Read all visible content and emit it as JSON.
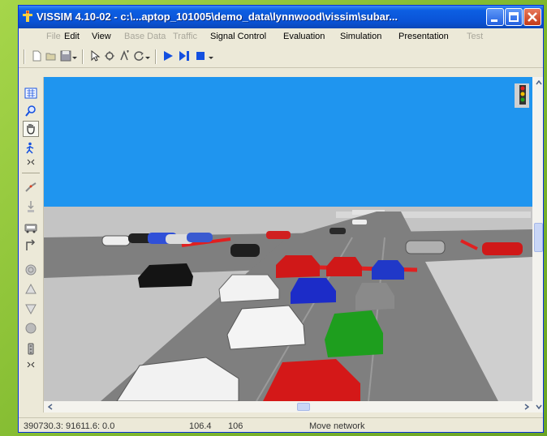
{
  "window": {
    "title": "VISSIM 4.10-02 - c:\\...aptop_101005\\demo_data\\lynnwood\\vissim\\subar...",
    "minimize_label": "minimize",
    "maximize_label": "maximize",
    "close_label": "close"
  },
  "menu": {
    "items": [
      {
        "label": "File",
        "enabled": false
      },
      {
        "label": "Edit",
        "enabled": true
      },
      {
        "label": "View",
        "enabled": true
      },
      {
        "label": "Base Data",
        "enabled": false
      },
      {
        "label": "Traffic",
        "enabled": false
      },
      {
        "label": "Signal Control",
        "enabled": true
      },
      {
        "label": "Evaluation",
        "enabled": true
      },
      {
        "label": "Simulation",
        "enabled": true
      },
      {
        "label": "Presentation",
        "enabled": true
      },
      {
        "label": "Test",
        "enabled": false
      }
    ]
  },
  "status": {
    "coordinates": "390730.3: 91611.6: 0.0",
    "value1": "106.4",
    "value2": "106",
    "mode": "Move network"
  },
  "colors": {
    "sky": "#1f95ef",
    "ground": "#c4c4c4",
    "road": "#7f7f7f",
    "accent": "#0a53d6"
  }
}
